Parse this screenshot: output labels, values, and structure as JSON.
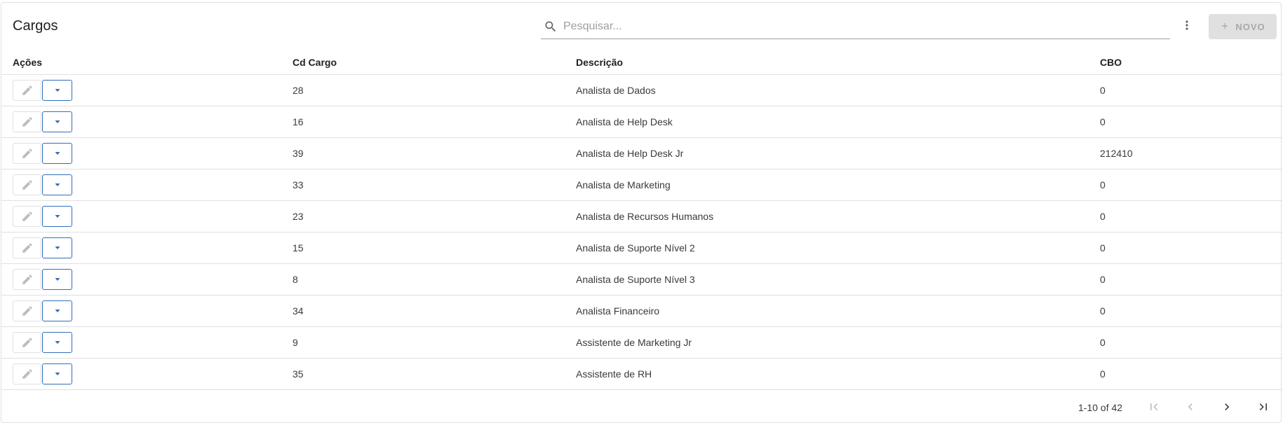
{
  "header": {
    "title": "Cargos",
    "search_placeholder": "Pesquisar...",
    "new_label": "NOVO"
  },
  "table": {
    "columns": [
      "Ações",
      "Cd Cargo",
      "Descrição",
      "CBO"
    ],
    "rows": [
      {
        "cd": "28",
        "desc": "Analista de Dados",
        "cbo": "0"
      },
      {
        "cd": "16",
        "desc": "Analista de Help Desk",
        "cbo": "0"
      },
      {
        "cd": "39",
        "desc": "Analista de Help Desk Jr",
        "cbo": "212410"
      },
      {
        "cd": "33",
        "desc": "Analista de Marketing",
        "cbo": "0"
      },
      {
        "cd": "23",
        "desc": "Analista de Recursos Humanos",
        "cbo": "0"
      },
      {
        "cd": "15",
        "desc": "Analista de Suporte Nível 2",
        "cbo": "0"
      },
      {
        "cd": "8",
        "desc": "Analista de Suporte Nível 3",
        "cbo": "0"
      },
      {
        "cd": "34",
        "desc": "Analista Financeiro",
        "cbo": "0"
      },
      {
        "cd": "9",
        "desc": "Assistente de Marketing Jr",
        "cbo": "0"
      },
      {
        "cd": "35",
        "desc": "Assistente de RH",
        "cbo": "0"
      }
    ]
  },
  "pagination": {
    "range": "1-10 of 42"
  },
  "icons": {
    "search": "search-icon",
    "more": "more-vert-icon",
    "add": "plus-icon",
    "edit": "pencil-icon",
    "dropdown": "caret-down-icon",
    "first": "first-page-icon",
    "prev": "chevron-left-icon",
    "next": "chevron-right-icon",
    "last": "last-page-icon"
  },
  "colors": {
    "accent": "#2f6fb8",
    "disabled_bg": "#e0e0e0",
    "border": "#e0e0e0"
  }
}
